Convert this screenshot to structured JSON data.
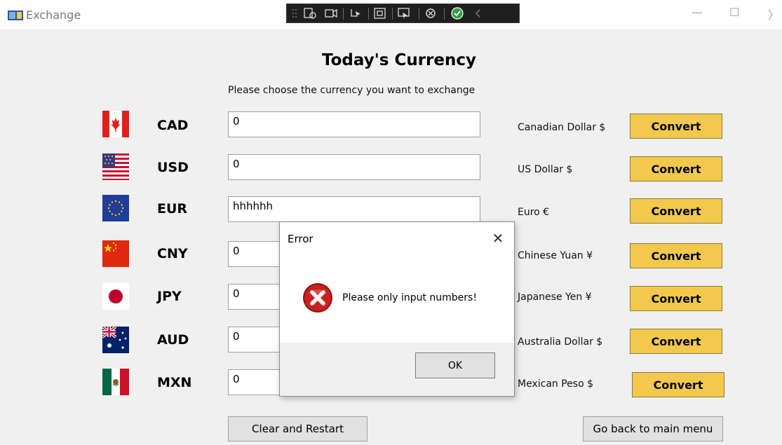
{
  "window": {
    "title": "Exchange",
    "controls": {
      "minimize": "—",
      "maximize": "☐",
      "more": "〉"
    }
  },
  "page": {
    "title": "Today's Currency",
    "subtitle": "Please choose the currency you want to exchange"
  },
  "currencies": [
    {
      "code": "CAD",
      "amount": "0",
      "name": "Canadian Dollar $",
      "flag": "canada-flag-icon"
    },
    {
      "code": "USD",
      "amount": "0",
      "name": "US Dollar $",
      "flag": "usa-flag-icon"
    },
    {
      "code": "EUR",
      "amount": "hhhhhh",
      "name": "Euro €",
      "flag": "eu-flag-icon"
    },
    {
      "code": "CNY",
      "amount": "0",
      "name": "Chinese Yuan ¥",
      "flag": "china-flag-icon"
    },
    {
      "code": "JPY",
      "amount": "0",
      "name": "Japanese Yen ¥",
      "flag": "japan-flag-icon"
    },
    {
      "code": "AUD",
      "amount": "0",
      "name": "Australia Dollar $",
      "flag": "australia-flag-icon"
    },
    {
      "code": "MXN",
      "amount": "0",
      "name": "Mexican Peso $",
      "flag": "mexico-flag-icon"
    }
  ],
  "convert_label": "Convert",
  "footer": {
    "clear_label": "Clear and Restart",
    "back_label": "Go back to main menu"
  },
  "dialog": {
    "title": "Error",
    "close": "✕",
    "message": "Please only input numbers!",
    "ok_label": "OK",
    "icon": "error-icon"
  },
  "colors": {
    "convert_button": "#f2c94c",
    "background": "#f0f0f0",
    "error_red": "#c8211f"
  }
}
